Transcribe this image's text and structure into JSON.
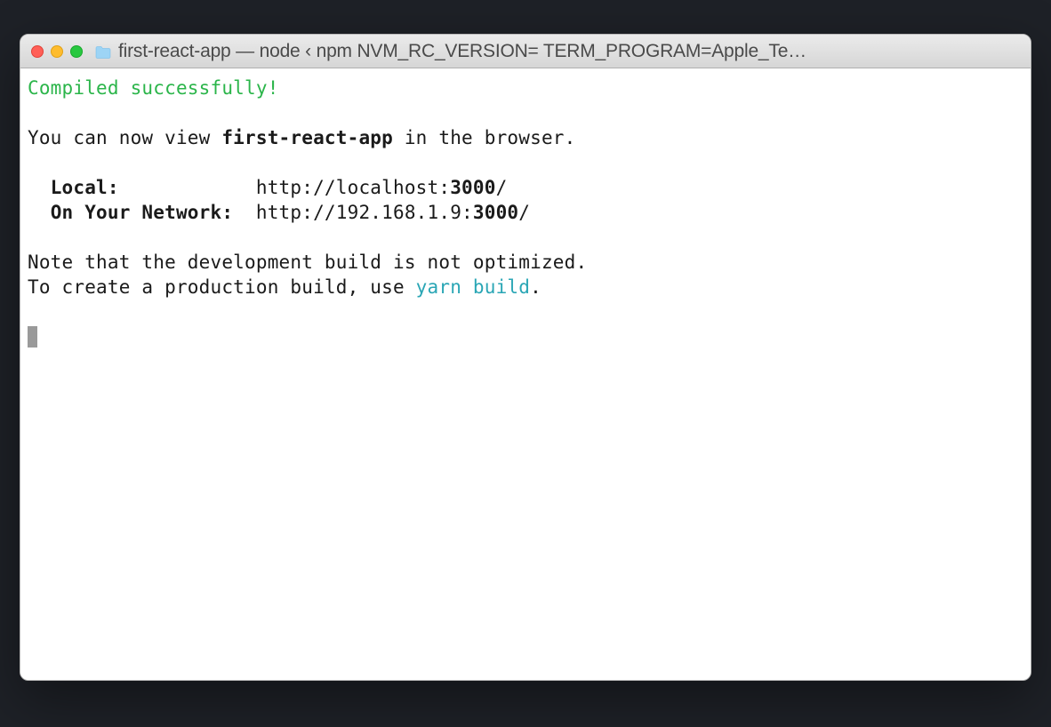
{
  "window": {
    "title": "first-react-app — node ‹ npm NVM_RC_VERSION= TERM_PROGRAM=Apple_Te…"
  },
  "terminal": {
    "compiled": "Compiled successfully!",
    "view_prefix": "You can now view ",
    "app_name": "first-react-app",
    "view_suffix": " in the browser.",
    "local_label": "Local:",
    "local_pad": "            ",
    "local_url_pre": "http://localhost:",
    "local_port": "3000",
    "local_url_post": "/",
    "network_label": "On Your Network:",
    "network_pad": "  ",
    "network_url_pre": "http://192.168.1.9:",
    "network_port": "3000",
    "network_url_post": "/",
    "note1": "Note that the development build is not optimized.",
    "note2_pre": "To create a production build, use ",
    "build_cmd": "yarn build",
    "note2_post": "."
  }
}
